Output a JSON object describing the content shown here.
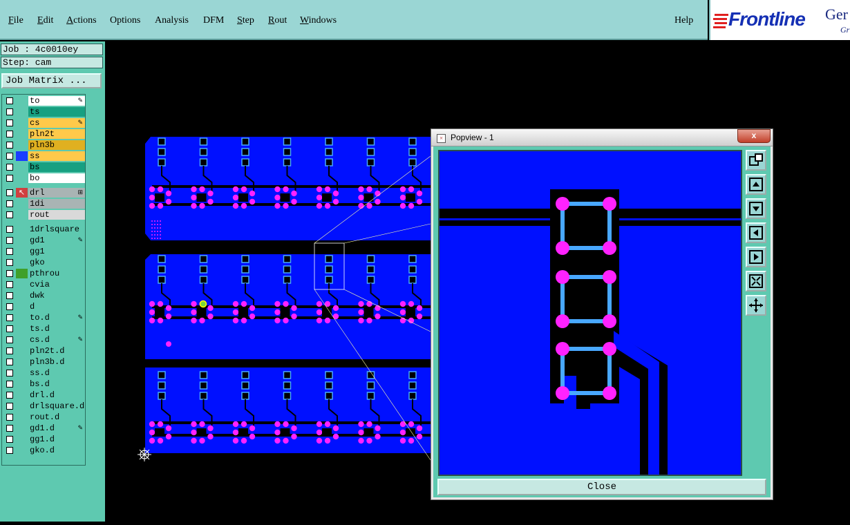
{
  "menu": {
    "file": "File",
    "edit": "Edit",
    "actions": "Actions",
    "options": "Options",
    "analysis": "Analysis",
    "dfm": "DFM",
    "step": "Step",
    "rout": "Rout",
    "windows": "Windows",
    "help": "Help"
  },
  "brand": {
    "logo": "Frontline",
    "suffix": "Ger",
    "suffix2": "Gr"
  },
  "job": {
    "job_line": "Job : 4c0010ey",
    "step_line": "Step: cam",
    "matrix_button": "Job Matrix ..."
  },
  "layers_group1": [
    {
      "name": "to",
      "color": "#ffffff",
      "marker": "pencil"
    },
    {
      "name": "ts",
      "color": "#17a081",
      "marker": ""
    },
    {
      "name": "cs",
      "color": "#ffc94a",
      "marker": "pencil"
    },
    {
      "name": "pln2t",
      "color": "#ffc94a",
      "marker": ""
    },
    {
      "name": "pln3b",
      "color": "#e0b020",
      "marker": ""
    },
    {
      "name": "ss",
      "color": "#ffc94a",
      "marker": ""
    },
    {
      "name": "bs",
      "color": "#17a081",
      "marker": ""
    },
    {
      "name": "bo",
      "color": "#ffffff",
      "marker": ""
    }
  ],
  "layers_group2": [
    {
      "name": "drl",
      "color": "#a9b4b4",
      "marker": "grid"
    },
    {
      "name": "1di",
      "color": "#a9b4b4",
      "marker": ""
    },
    {
      "name": "rout",
      "color": "#d9d9d9",
      "marker": ""
    }
  ],
  "layers_group3": [
    {
      "name": "1drlsquare",
      "color": "#5ec9b0",
      "marker": ""
    },
    {
      "name": "gd1",
      "color": "#5ec9b0",
      "marker": "pencil"
    },
    {
      "name": "gg1",
      "color": "#5ec9b0",
      "marker": ""
    },
    {
      "name": "gko",
      "color": "#5ec9b0",
      "marker": ""
    },
    {
      "name": "pthrou",
      "color": "#5ec9b0",
      "marker": ""
    },
    {
      "name": "cvia",
      "color": "#5ec9b0",
      "marker": ""
    },
    {
      "name": "dwk",
      "color": "#5ec9b0",
      "marker": ""
    },
    {
      "name": "d",
      "color": "#5ec9b0",
      "marker": ""
    },
    {
      "name": "to.d",
      "color": "#5ec9b0",
      "marker": "pencil"
    },
    {
      "name": "ts.d",
      "color": "#5ec9b0",
      "marker": ""
    },
    {
      "name": "cs.d",
      "color": "#5ec9b0",
      "marker": "pencil"
    },
    {
      "name": "pln2t.d",
      "color": "#5ec9b0",
      "marker": ""
    },
    {
      "name": "pln3b.d",
      "color": "#5ec9b0",
      "marker": ""
    },
    {
      "name": "ss.d",
      "color": "#5ec9b0",
      "marker": ""
    },
    {
      "name": "bs.d",
      "color": "#5ec9b0",
      "marker": ""
    },
    {
      "name": "drl.d",
      "color": "#5ec9b0",
      "marker": ""
    },
    {
      "name": "drlsquare.d",
      "color": "#5ec9b0",
      "marker": ""
    },
    {
      "name": "rout.d",
      "color": "#5ec9b0",
      "marker": ""
    },
    {
      "name": "gd1.d",
      "color": "#5ec9b0",
      "marker": "pencil"
    },
    {
      "name": "gg1.d",
      "color": "#5ec9b0",
      "marker": ""
    },
    {
      "name": "gko.d",
      "color": "#5ec9b0",
      "marker": ""
    }
  ],
  "popview": {
    "title": "Popview - 1",
    "close_x": "x",
    "close_button": "Close"
  },
  "colors": {
    "board": "#0010ff",
    "pad": "#ff22ff",
    "square": "#49a8ff",
    "panel": "#5ec9b0",
    "menubar": "#9ad6d4"
  }
}
